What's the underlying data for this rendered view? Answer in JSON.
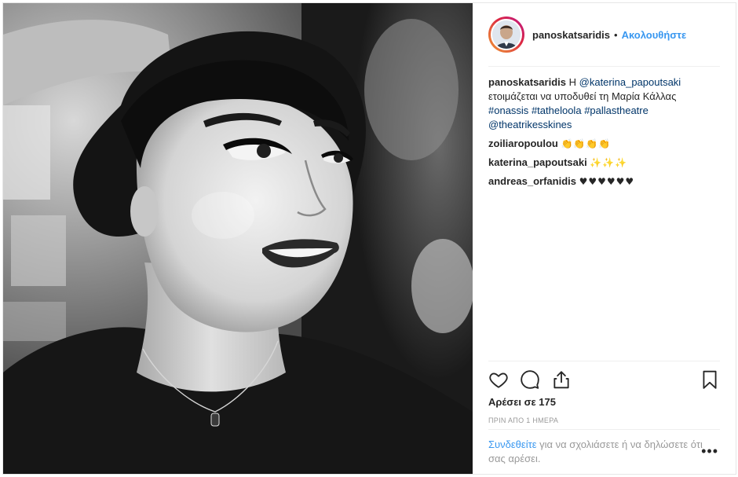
{
  "post": {
    "author": "panoskatsaridis",
    "separator": "•",
    "follow_label": "Ακολουθήστε",
    "caption": {
      "author": "panoskatsaridis",
      "prefix": "Η",
      "mention": "@katerina_papoutsaki",
      "text": "ετοιμάζεται να υποδυθεί τη Μαρία Κάλλας",
      "hashtags": [
        "#onassis",
        "#tatheloola",
        "#pallastheatre"
      ],
      "mention2": "@theatrikesskines"
    },
    "comments": [
      {
        "user": "zoiliaropoulou",
        "text": "👏👏👏👏"
      },
      {
        "user": "katerina_papoutsaki",
        "text": "✨✨✨"
      },
      {
        "user": "andreas_orfanidis",
        "text": "♥♥♥♥♥♥"
      }
    ],
    "likes_text": "Αρέσει σε 175",
    "timestamp": "ΠΡΙΝ ΑΠΟ 1 ΗΜΕΡΑ",
    "footer": {
      "login_label": "Συνδεθείτε",
      "rest": "για να σχολιάσετε ή να δηλώσετε ότι σας αρέσει."
    },
    "more_label": "•••"
  },
  "icons": {
    "like": "heart-icon",
    "comment": "comment-icon",
    "share": "share-icon",
    "save": "bookmark-icon",
    "more": "more-options-icon"
  },
  "colors": {
    "link_blue": "#3897f0",
    "mention_blue": "#003569",
    "text": "#262626",
    "muted": "#999999"
  }
}
